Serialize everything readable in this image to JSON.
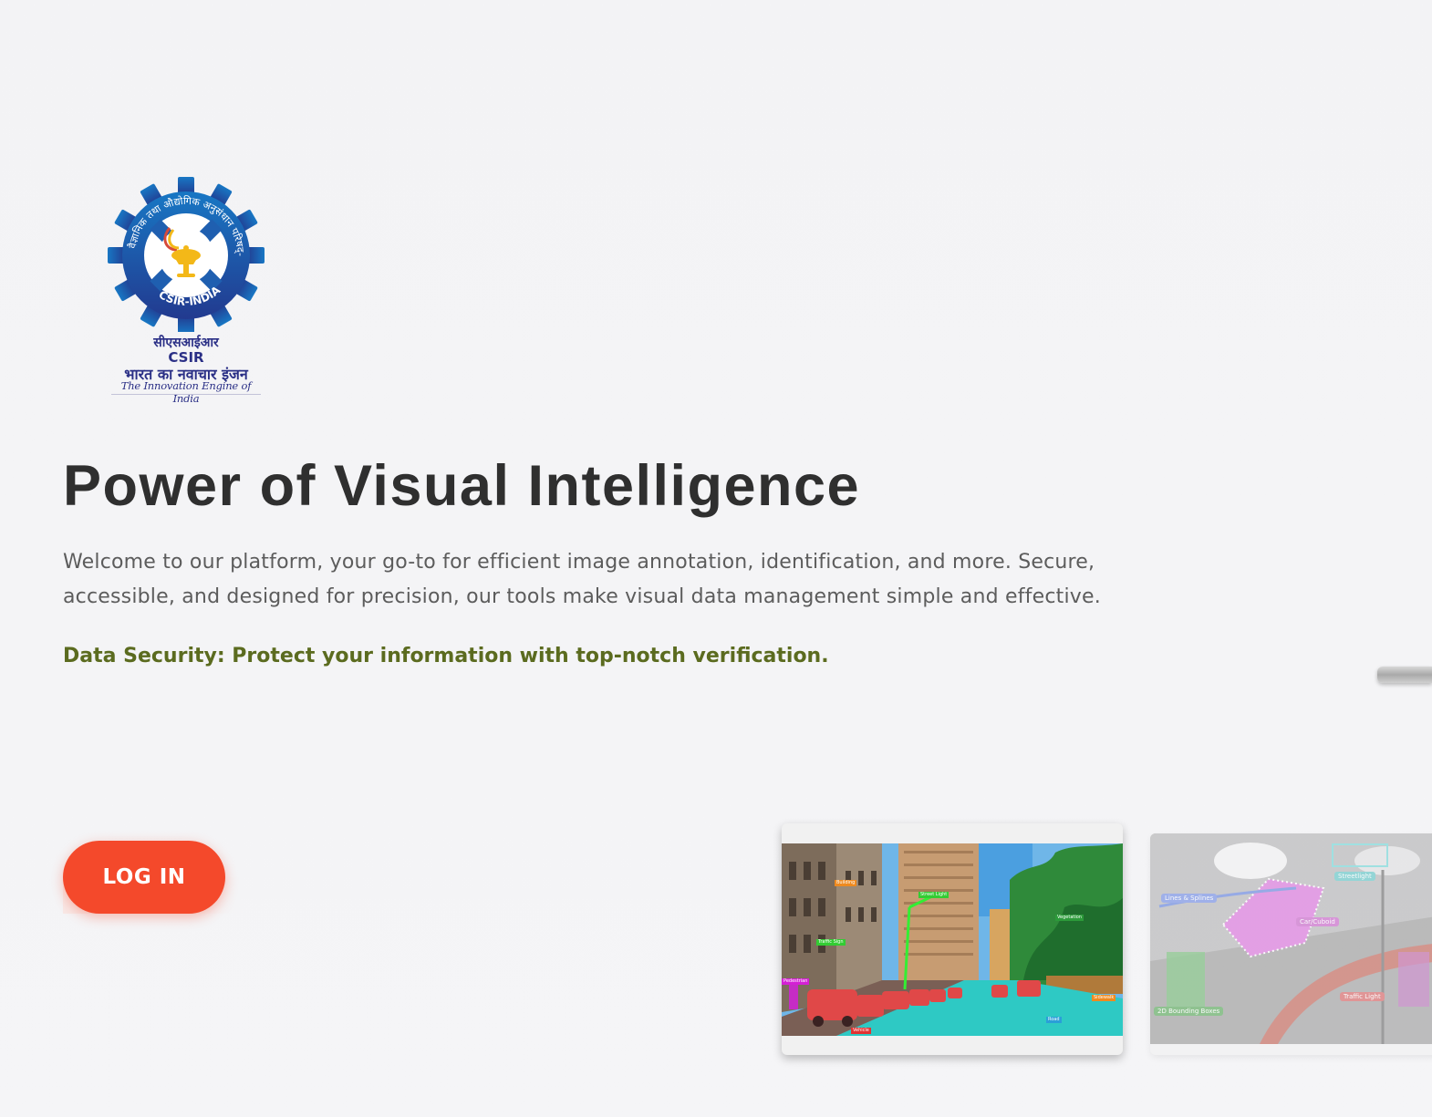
{
  "logo": {
    "ring_text": "वैज्ञानिक तथा औद्योगिक अनुसंधान परिषद्-भारत",
    "badge_text": "CSIR-INDIA",
    "hindi_name": "सीएसआईआर",
    "english_name": "CSIR",
    "hindi_tagline": "भारत का नवाचार इंजन",
    "tagline": "The Innovation Engine of India"
  },
  "hero": {
    "title": "Power of Visual Intelligence",
    "description": "Welcome to our platform, your go-to for efficient image annotation, identification, and more. Secure, accessible, and designed for precision, our tools make visual data management simple and effective.",
    "security_line": "Data Security: Protect your information with top-notch verification."
  },
  "login": {
    "label": "LOG IN"
  },
  "colors": {
    "accent": "#f4492b",
    "title": "#2f2f2f",
    "security": "#5b6b1f",
    "logo_blue": "#1f5fb0"
  },
  "gallery": {
    "card1_tags": {
      "building": "Building",
      "street_light": "Street Light",
      "sign": "Traffic Sign",
      "pedestrian": "Pedestrian",
      "vehicle": "Vehicle",
      "tree": "Vegetation",
      "sidewalk": "Sidewalk",
      "road": "Road"
    },
    "card2_tags": {
      "lines": "Lines & Splines",
      "cuboid": "Car/Cuboid",
      "streetlight": "Streetlight",
      "bbox": "2D Bounding Boxes",
      "traffic_light": "Traffic Light"
    }
  }
}
